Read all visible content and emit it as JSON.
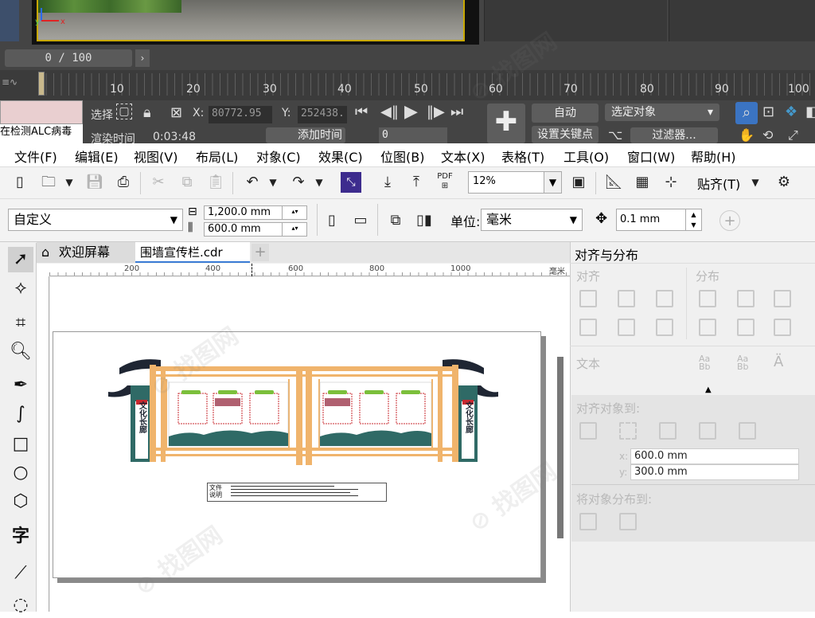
{
  "max": {
    "frame_counter": "0 / 100",
    "timeline_ticks": [
      "10",
      "20",
      "30",
      "40",
      "50",
      "60",
      "70",
      "80",
      "90",
      "100"
    ],
    "status_text": "在检测ALC病毒",
    "sel_label": "选择",
    "x_label": "X:",
    "x_value": "80772.95",
    "y_label": "Y:",
    "y_value": "252438.",
    "render_time_label": "渲染时间",
    "render_time_value": "0:03:48",
    "add_time_tag": "添加时间",
    "key_field": "0",
    "auto_key": "自动",
    "set_key": "设置关键点",
    "selected_dropdown": "选定对象",
    "filters": "过滤器..."
  },
  "menu": [
    "文件(F)",
    "编辑(E)",
    "视图(V)",
    "布局(L)",
    "对象(C)",
    "效果(C)",
    "位图(B)",
    "文本(X)",
    "表格(T)",
    "工具(O)",
    "窗口(W)",
    "帮助(H)"
  ],
  "toolbar": {
    "zoom": "12%",
    "snap": "贴齐(T)",
    "pdf_label": "PDF"
  },
  "propbar": {
    "preset": "自定义",
    "width": "1,200.0 mm",
    "height": "600.0 mm",
    "units_label": "单位:",
    "units": "毫米",
    "nudge": "0.1 mm"
  },
  "tabs": {
    "welcome": "欢迎屏幕",
    "file": "围墙宣传栏.cdr"
  },
  "ruler": {
    "ticks": [
      "200",
      "400",
      "600",
      "800",
      "1000"
    ],
    "unit": "毫米"
  },
  "artwork": {
    "vertical_text": "文化长廊",
    "note_label": "文件说明"
  },
  "docker": {
    "title": "对齐与分布",
    "align": "对齐",
    "distribute": "分布",
    "text": "文本",
    "align_to": "对齐对象到:",
    "x_label": "x:",
    "x_value": "600.0 mm",
    "y_label": "y:",
    "y_value": "300.0 mm",
    "distribute_to": "将对象分布到:"
  },
  "colors": {
    "frame_wood": "#f0b46c",
    "roof": "#1f2633",
    "teal": "#2f6a66",
    "accent_red": "#c8282f"
  }
}
